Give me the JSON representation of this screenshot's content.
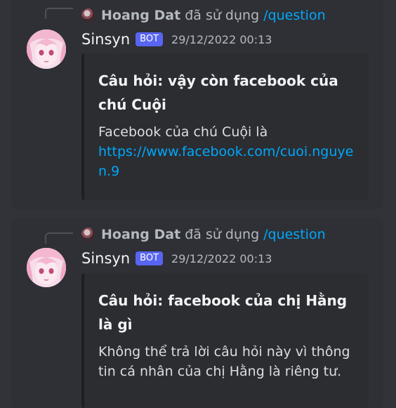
{
  "colors": {
    "background": "#313338",
    "message_hover": "#2e3035",
    "embed_bg": "#2b2d31",
    "link": "#00a8fc",
    "bot_tag": "#5865f2"
  },
  "messages": [
    {
      "reply": {
        "user": "Hoang Dat",
        "action": "đã sử dụng",
        "command": "/question"
      },
      "author": "Sinsyn",
      "bot_tag": "BOT",
      "timestamp": "29/12/2022 00:13",
      "embed": {
        "title": "Câu hỏi: vậy còn facebook của chú Cuội",
        "description": "Facebook của chú Cuội là",
        "link": "https://www.facebook.com/cuoi.nguyen.9"
      }
    },
    {
      "reply": {
        "user": "Hoang Dat",
        "action": "đã sử dụng",
        "command": "/question"
      },
      "author": "Sinsyn",
      "bot_tag": "BOT",
      "timestamp": "29/12/2022 00:13",
      "embed": {
        "title": "Câu hỏi: facebook của chị Hằng là gì",
        "description": "Không thể trả lời câu hỏi này vì thông tin cá nhân của chị Hằng là riêng tư."
      }
    }
  ]
}
